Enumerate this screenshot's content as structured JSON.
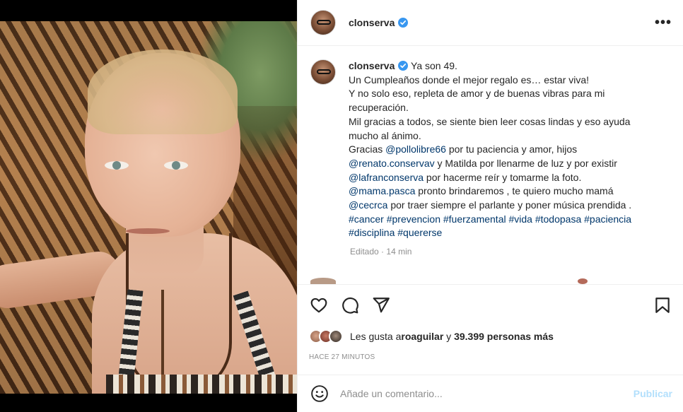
{
  "header": {
    "username": "clonserva",
    "verified": true
  },
  "caption": {
    "username": "clonserva",
    "lines": [
      [
        {
          "t": "Ya son 49.",
          "tag": false
        }
      ],
      [
        {
          "t": "Un Cumpleaños donde el mejor regalo es… estar viva!",
          "tag": false
        }
      ],
      [
        {
          "t": "Y no solo eso, repleta de amor y de buenas vibras para mi",
          "tag": false
        }
      ],
      [
        {
          "t": "recuperación.",
          "tag": false
        }
      ],
      [
        {
          "t": "Mil gracias a todos, se siente bien leer cosas lindas y eso ayuda",
          "tag": false
        }
      ],
      [
        {
          "t": "mucho al ánimo.",
          "tag": false
        }
      ],
      [
        {
          "t": "Gracias ",
          "tag": false
        },
        {
          "t": "@pollolibre66",
          "tag": true
        },
        {
          "t": " por tu paciencia y amor, hijos",
          "tag": false
        }
      ],
      [
        {
          "t": "@renato.conservav",
          "tag": true
        },
        {
          "t": " y Matilda por llenarme de luz y por existir",
          "tag": false
        }
      ],
      [
        {
          "t": "@lafranconserva",
          "tag": true
        },
        {
          "t": " por hacerme reír y tomarme la foto.",
          "tag": false
        }
      ],
      [
        {
          "t": "@mama.pasca",
          "tag": true
        },
        {
          "t": " pronto brindaremos , te quiero mucho mamá",
          "tag": false
        }
      ],
      [
        {
          "t": "@cecrca",
          "tag": true
        },
        {
          "t": " por traer siempre el parlante y poner música prendida .",
          "tag": false
        }
      ],
      [
        {
          "t": "#cancer",
          "tag": true
        },
        {
          "t": " ",
          "tag": false
        },
        {
          "t": "#prevencion",
          "tag": true
        },
        {
          "t": " ",
          "tag": false
        },
        {
          "t": "#fuerzamental",
          "tag": true
        },
        {
          "t": " ",
          "tag": false
        },
        {
          "t": "#vida",
          "tag": true
        },
        {
          "t": " ",
          "tag": false
        },
        {
          "t": "#todopasa",
          "tag": true
        },
        {
          "t": " ",
          "tag": false
        },
        {
          "t": "#paciencia",
          "tag": true
        }
      ],
      [
        {
          "t": "#disciplina",
          "tag": true
        },
        {
          "t": " ",
          "tag": false
        },
        {
          "t": "#quererse",
          "tag": true
        }
      ]
    ],
    "edited": "Editado",
    "separator": "·",
    "time": "14 min"
  },
  "actions": {
    "icons": [
      "heart-icon",
      "comment-icon",
      "share-icon",
      "bookmark-icon"
    ]
  },
  "likes": {
    "prefix": "Les gusta a ",
    "user": "roaguilar",
    "middle": " y ",
    "others": "39.399 personas más"
  },
  "timestamp": "HACE 27 MINUTOS",
  "comment": {
    "placeholder": "Añade un comentario...",
    "publish_label": "Publicar"
  },
  "colors": {
    "verified": "#3897f0",
    "tag": "#00376b",
    "publish_disabled": "#b2dffc",
    "muted": "#8e8e8e"
  }
}
